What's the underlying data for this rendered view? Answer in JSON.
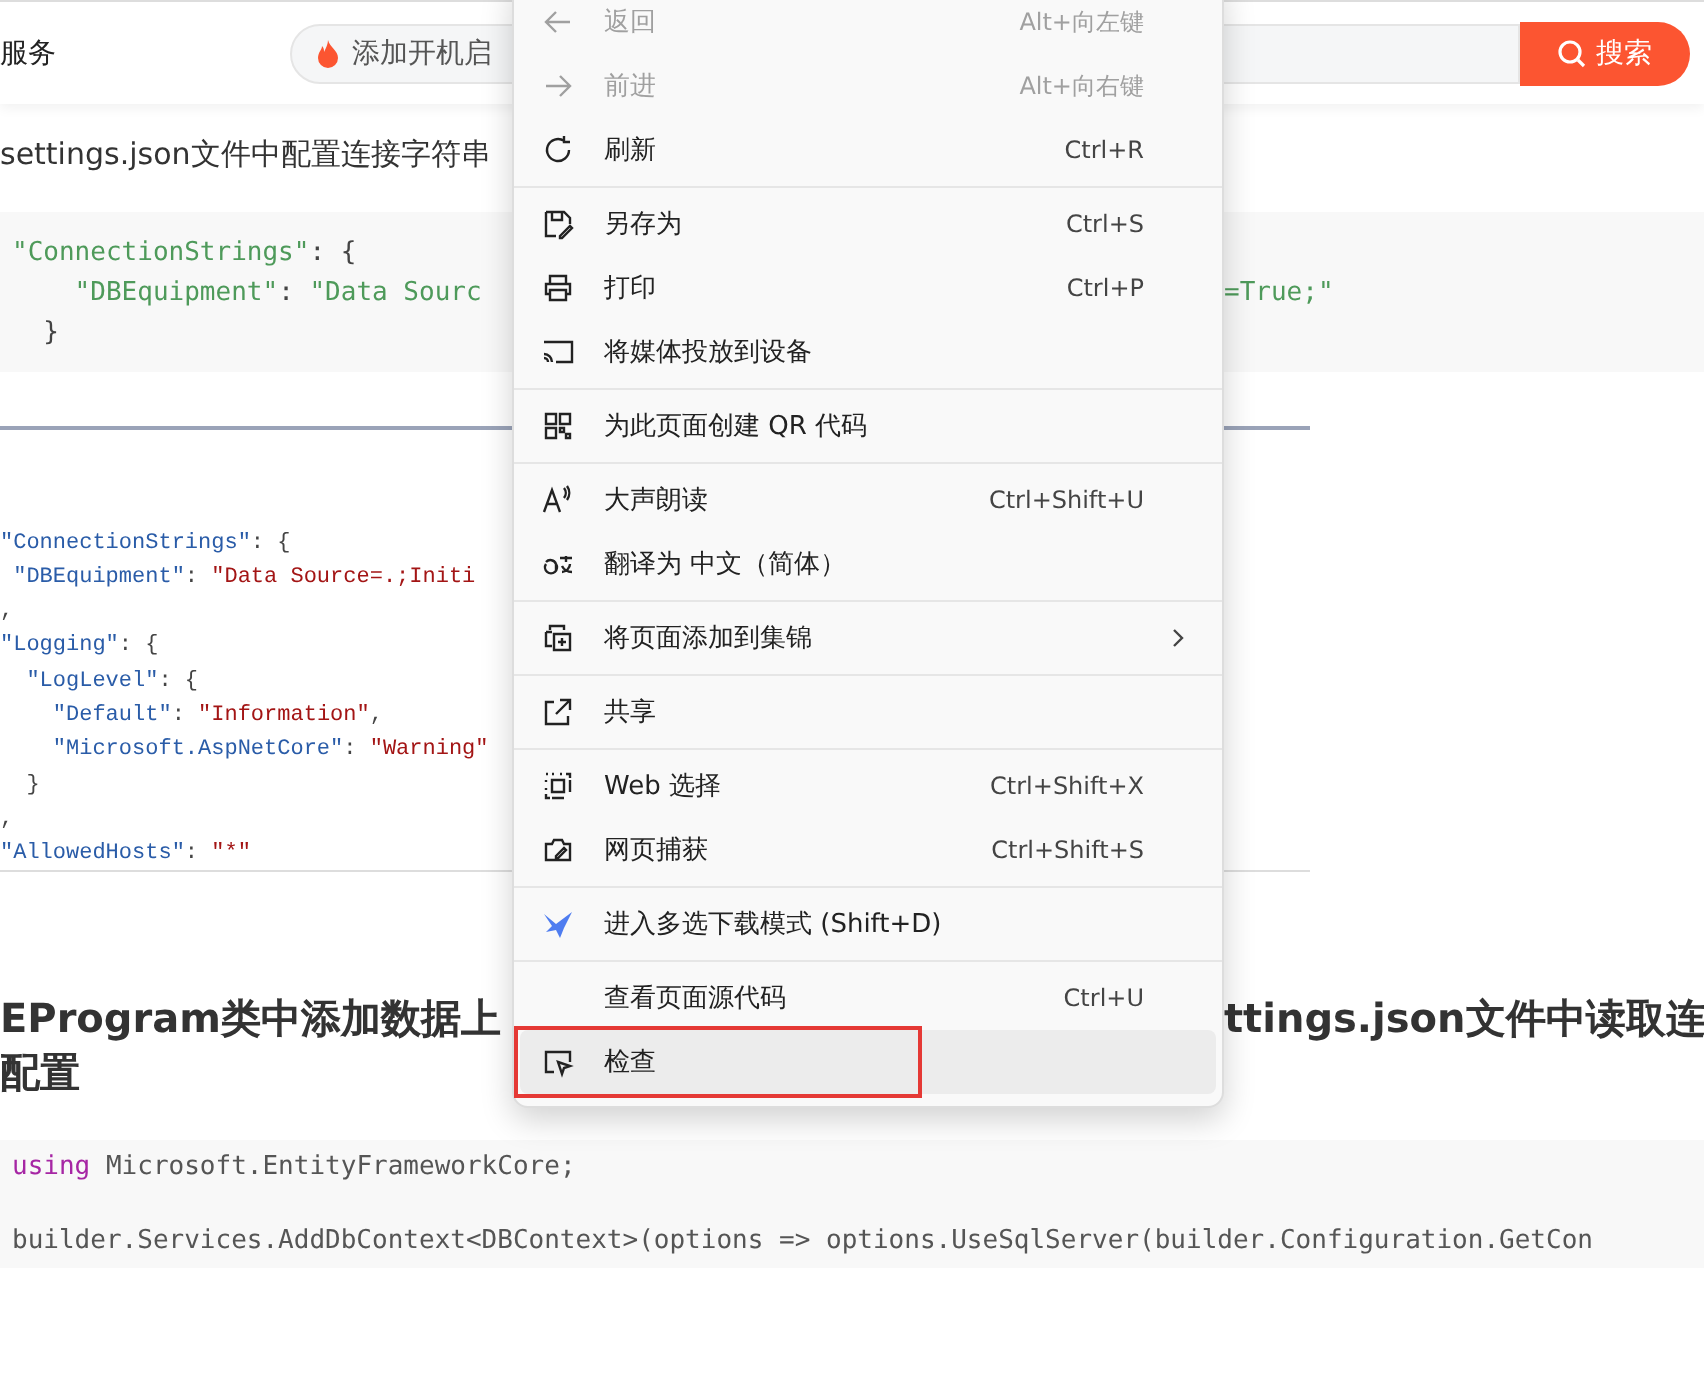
{
  "top_bar": {
    "site_text": "服务",
    "search": {
      "value": "添加开机启"
    },
    "search_button": "搜索"
  },
  "article": {
    "heading_1": "settings.json文件中配置连接字符串",
    "code_1": [
      {
        "left": [
          {
            "t": "\"ConnectionStrings\"",
            "kind": "string"
          },
          {
            "t": ": {",
            "kind": "punct"
          }
        ]
      },
      {
        "left": [
          {
            "t": "    \"DBEquipment\"",
            "kind": "string"
          },
          {
            "t": ": ",
            "kind": "punct"
          },
          {
            "t": "\"Data Sourc",
            "kind": "string"
          }
        ],
        "right": [
          {
            "t": "=True;\"",
            "kind": "string"
          }
        ]
      },
      {
        "left": [
          {
            "t": "  }",
            "kind": "punct"
          }
        ]
      }
    ],
    "figure": {
      "lines": [
        [
          {
            "t": "\"ConnectionStrings\"",
            "kind": "key"
          },
          {
            "t": ": {",
            "kind": "punct"
          }
        ],
        [
          {
            "t": " \"DBEquipment\"",
            "kind": "key"
          },
          {
            "t": ": ",
            "kind": "punct"
          },
          {
            "t": "\"Data Source=.;Initi",
            "kind": "value"
          }
        ],
        [
          {
            "t": ",",
            "kind": "punct"
          }
        ],
        [
          {
            "t": "\"Logging\"",
            "kind": "key"
          },
          {
            "t": ": {",
            "kind": "punct"
          }
        ],
        [
          {
            "t": "  \"LogLevel\"",
            "kind": "key"
          },
          {
            "t": ": {",
            "kind": "punct"
          }
        ],
        [
          {
            "t": "    \"Default\"",
            "kind": "key"
          },
          {
            "t": ": ",
            "kind": "punct"
          },
          {
            "t": "\"Information\"",
            "kind": "value"
          },
          {
            "t": ",",
            "kind": "punct"
          }
        ],
        [
          {
            "t": "    \"Microsoft.AspNetCore\"",
            "kind": "key"
          },
          {
            "t": ": ",
            "kind": "punct"
          },
          {
            "t": "\"Warning\"",
            "kind": "value"
          }
        ],
        [
          {
            "t": "  }",
            "kind": "punct"
          }
        ],
        [
          {
            "t": ",",
            "kind": "punct"
          }
        ],
        [
          {
            "t": "\"AllowedHosts\"",
            "kind": "key"
          },
          {
            "t": ": ",
            "kind": "punct"
          },
          {
            "t": "\"*\"",
            "kind": "value"
          }
        ]
      ]
    },
    "heading_2": {
      "left": "EProgram类中添加数据上",
      "right": "ttings.json文件中读取连",
      "line_2": "配置"
    },
    "code_2": [
      [
        {
          "t": "using",
          "kind": "keyword"
        },
        {
          "t": " Microsoft.EntityFrameworkCore;",
          "kind": "plain"
        }
      ],
      [
        {
          "t": "builder.Services.AddDbContext<DBContext>(options => options.UseSqlServer(builder.Configuration.GetCon",
          "kind": "plain"
        }
      ]
    ]
  },
  "context_menu": {
    "groups": [
      [
        {
          "label": "返回",
          "shortcut": "Alt+向左键",
          "disabled": true,
          "submenu": false,
          "selected": false,
          "outlined": false
        },
        {
          "label": "前进",
          "shortcut": "Alt+向右键",
          "disabled": true,
          "submenu": false,
          "selected": false,
          "outlined": false
        },
        {
          "label": "刷新",
          "shortcut": "Ctrl+R",
          "disabled": false,
          "submenu": false,
          "selected": false,
          "outlined": false
        }
      ],
      [
        {
          "label": "另存为",
          "shortcut": "Ctrl+S",
          "disabled": false,
          "submenu": false,
          "selected": false,
          "outlined": false
        },
        {
          "label": "打印",
          "shortcut": "Ctrl+P",
          "disabled": false,
          "submenu": false,
          "selected": false,
          "outlined": false
        },
        {
          "label": "将媒体投放到设备",
          "disabled": false,
          "submenu": false,
          "selected": false,
          "outlined": false
        }
      ],
      [
        {
          "label": "为此页面创建 QR 代码",
          "disabled": false,
          "submenu": false,
          "selected": false,
          "outlined": false
        }
      ],
      [
        {
          "label": "大声朗读",
          "shortcut": "Ctrl+Shift+U",
          "disabled": false,
          "submenu": false,
          "selected": false,
          "outlined": false
        },
        {
          "label": "翻译为 中文（简体）",
          "disabled": false,
          "submenu": false,
          "selected": false,
          "outlined": false
        }
      ],
      [
        {
          "label": "将页面添加到集锦",
          "disabled": false,
          "submenu": true,
          "selected": false,
          "outlined": false
        }
      ],
      [
        {
          "label": "共享",
          "disabled": false,
          "submenu": false,
          "selected": false,
          "outlined": false
        }
      ],
      [
        {
          "label": "Web 选择",
          "shortcut": "Ctrl+Shift+X",
          "disabled": false,
          "submenu": false,
          "selected": false,
          "outlined": false
        },
        {
          "label": "网页捕获",
          "shortcut": "Ctrl+Shift+S",
          "disabled": false,
          "submenu": false,
          "selected": false,
          "outlined": false
        }
      ],
      [
        {
          "label": "进入多选下载模式 (Shift+D)",
          "disabled": false,
          "submenu": false,
          "selected": false,
          "outlined": false
        }
      ],
      [
        {
          "label": "查看页面源代码",
          "shortcut": "Ctrl+U",
          "disabled": false,
          "submenu": false,
          "selected": false,
          "outlined": false
        },
        {
          "label": "检查",
          "disabled": false,
          "submenu": false,
          "selected": true,
          "outlined": true
        }
      ]
    ]
  }
}
